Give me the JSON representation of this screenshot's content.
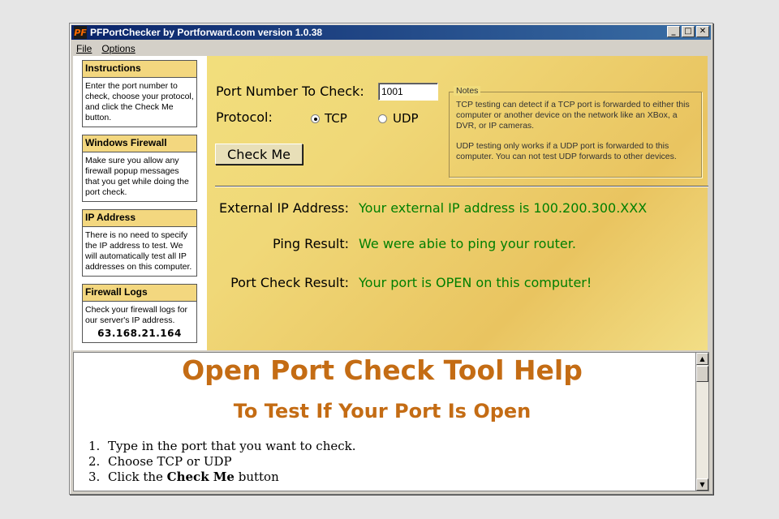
{
  "window": {
    "title": "PFPortChecker by Portforward.com version 1.0.38",
    "app_icon": "PF"
  },
  "menu": {
    "file": "File",
    "options": "Options"
  },
  "sidebar": [
    {
      "title": "Instructions",
      "body": "Enter the port number to check, choose your protocol, and click the Check Me button."
    },
    {
      "title": "Windows Firewall",
      "body": "Make sure you allow any firewall popup messages that you get while doing the port check."
    },
    {
      "title": "IP Address",
      "body": "There is no need to specify the IP address to test. We will automatically test all IP addresses on this computer."
    },
    {
      "title": "Firewall Logs",
      "body": "Check your firewall logs for our server's IP address.",
      "ip": "63.168.21.164"
    }
  ],
  "form": {
    "port_label": "Port Number To Check:",
    "port_value": "1001",
    "protocol_label": "Protocol:",
    "tcp": "TCP",
    "udp": "UDP",
    "selected_protocol": "TCP",
    "check_button": "Check Me"
  },
  "notes": {
    "legend": "Notes",
    "tcp_note": "TCP testing can detect if a TCP port is forwarded to either this computer or another device on the network like an XBox, a DVR, or IP cameras.",
    "udp_note": "UDP testing only works if a UDP port is forwarded to this computer. You can not test UDP forwards to other devices."
  },
  "results": {
    "external_ip_label": "External IP Address:",
    "external_ip_value": "Your external IP address is 100.200.300.XXX",
    "ping_label": "Ping Result:",
    "ping_value": "We were abie to ping your router.",
    "port_check_label": "Port Check Result:",
    "port_check_value": "Your port is OPEN on this computer!"
  },
  "help": {
    "heading": "Open Port Check Tool Help",
    "subheading": "To Test If Your Port Is Open",
    "steps": [
      {
        "num": "1.",
        "text": "Type in the port that you want to check."
      },
      {
        "num": "2.",
        "text": "Choose TCP or UDP"
      },
      {
        "num": "3.",
        "pre": "Click the ",
        "bold": "Check Me",
        "post": " button"
      }
    ]
  }
}
